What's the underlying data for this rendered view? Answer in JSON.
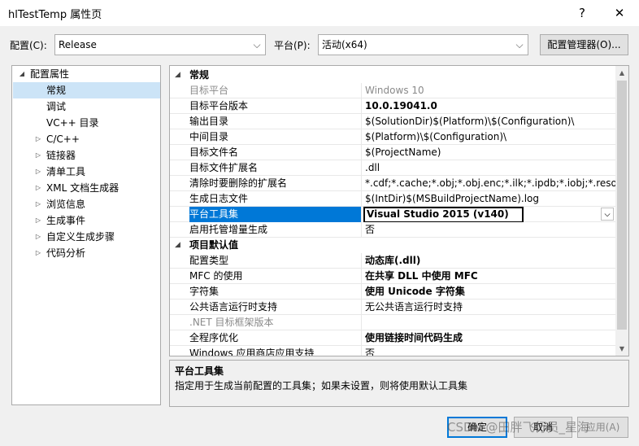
{
  "window": {
    "title": "hlTestTemp 属性页",
    "help": "?",
    "close": "✕"
  },
  "toolbar": {
    "config_label": "配置(C):",
    "config_value": "Release",
    "platform_label": "平台(P):",
    "platform_value": "活动(x64)",
    "manager_button": "配置管理器(O)..."
  },
  "tree": {
    "root": "配置属性",
    "items": [
      {
        "label": "常规",
        "expandable": false,
        "selected": true
      },
      {
        "label": "调试",
        "expandable": false
      },
      {
        "label": "VC++ 目录",
        "expandable": false
      },
      {
        "label": "C/C++",
        "expandable": true
      },
      {
        "label": "链接器",
        "expandable": true
      },
      {
        "label": "清单工具",
        "expandable": true
      },
      {
        "label": "XML 文档生成器",
        "expandable": true
      },
      {
        "label": "浏览信息",
        "expandable": true
      },
      {
        "label": "生成事件",
        "expandable": true
      },
      {
        "label": "自定义生成步骤",
        "expandable": true
      },
      {
        "label": "代码分析",
        "expandable": true
      }
    ]
  },
  "grid": {
    "section1": "常规",
    "rows1": [
      {
        "name": "目标平台",
        "value": "Windows 10"
      },
      {
        "name": "目标平台版本",
        "value": "10.0.19041.0"
      },
      {
        "name": "输出目录",
        "value": "$(SolutionDir)$(Platform)\\$(Configuration)\\"
      },
      {
        "name": "中间目录",
        "value": "$(Platform)\\$(Configuration)\\"
      },
      {
        "name": "目标文件名",
        "value": "$(ProjectName)"
      },
      {
        "name": "目标文件扩展名",
        "value": ".dll"
      },
      {
        "name": "清除时要删除的扩展名",
        "value": "*.cdf;*.cache;*.obj;*.obj.enc;*.ilk;*.ipdb;*.iobj;*.resources"
      },
      {
        "name": "生成日志文件",
        "value": "$(IntDir)$(MSBuildProjectName).log"
      },
      {
        "name": "平台工具集",
        "value": "Visual Studio 2015 (v140)"
      },
      {
        "name": "启用托管增量生成",
        "value": "否"
      }
    ],
    "section2": "项目默认值",
    "rows2": [
      {
        "name": "配置类型",
        "value": "动态库(.dll)"
      },
      {
        "name": "MFC 的使用",
        "value": "在共享 DLL 中使用 MFC"
      },
      {
        "name": "字符集",
        "value": "使用 Unicode 字符集"
      },
      {
        "name": "公共语言运行时支持",
        "value": "无公共语言运行时支持"
      },
      {
        "name": ".NET 目标框架版本",
        "value": ""
      },
      {
        "name": "全程序优化",
        "value": "使用链接时间代码生成"
      },
      {
        "name": "Windows 应用商店应用支持",
        "value": "否"
      }
    ]
  },
  "description": {
    "title": "平台工具集",
    "text": "指定用于生成当前配置的工具集；如果未设置，则将使用默认工具集"
  },
  "buttons": {
    "ok": "确定",
    "cancel": "取消",
    "apply": "应用(A)"
  },
  "watermark": "CSDN @田胖飞行员_星海",
  "colors": {
    "selection": "#0078d7",
    "background": "#f0f0f0"
  }
}
